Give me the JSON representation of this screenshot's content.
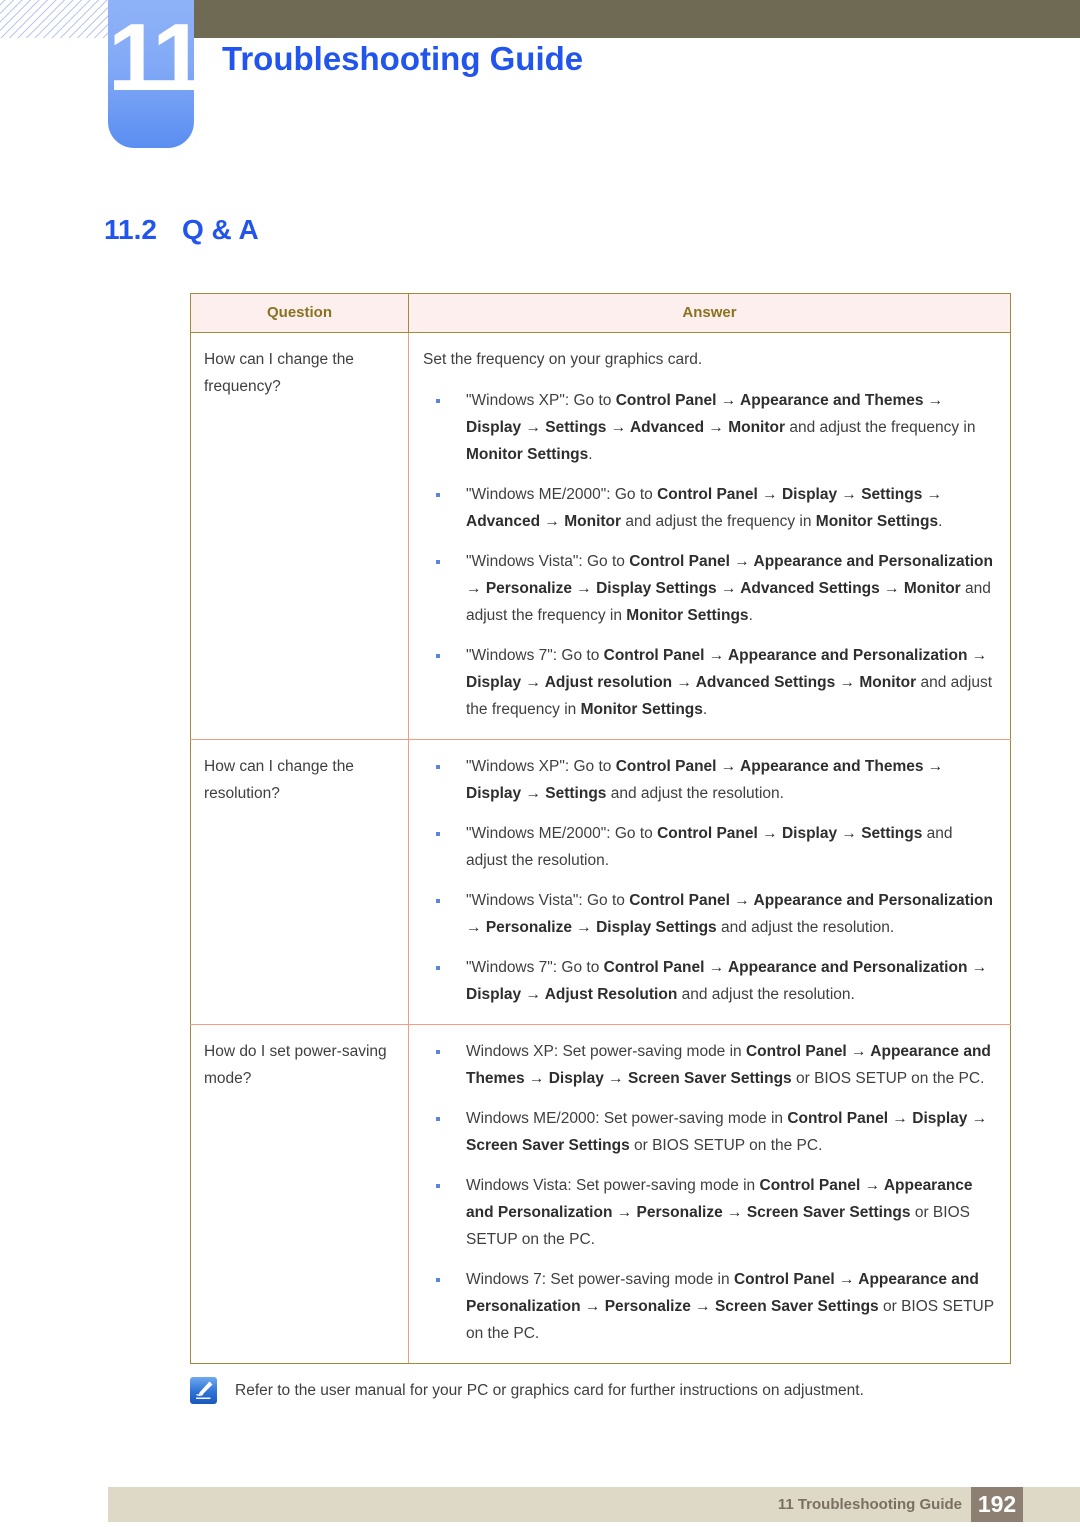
{
  "header": {
    "chapter_number": "11",
    "chapter_title": "Troubleshooting Guide",
    "accent_blue": "#2255ee",
    "khaki_bar_color": "#6e6a54",
    "number_block_color": "#82a9f6"
  },
  "section": {
    "number": "11.2",
    "title": "Q & A"
  },
  "table": {
    "columns": [
      "Question",
      "Answer"
    ],
    "header_text_color": "#8a7320",
    "header_bg_color": "#fcefee",
    "border_color": "#a38a38",
    "row_divider_color": "#ef9e83",
    "rows": [
      {
        "question": "How can I change the frequency?",
        "intro": "Set the frequency on your graphics card.",
        "bullets": [
          {
            "segments": [
              {
                "text": "\"Windows XP\": Go to ",
                "bold": false
              },
              {
                "text": "Control Panel",
                "bold": true
              },
              {
                "text": " → ",
                "bold": true
              },
              {
                "text": "Appearance and Themes",
                "bold": true
              },
              {
                "text": " → ",
                "bold": true
              },
              {
                "text": "Display",
                "bold": true
              },
              {
                "text": " → ",
                "bold": true
              },
              {
                "text": "Settings",
                "bold": true
              },
              {
                "text": " → ",
                "bold": true
              },
              {
                "text": "Advanced",
                "bold": true
              },
              {
                "text": " → ",
                "bold": true
              },
              {
                "text": "Monitor",
                "bold": true
              },
              {
                "text": " and adjust the frequency in ",
                "bold": false
              },
              {
                "text": "Monitor Settings",
                "bold": true
              },
              {
                "text": ".",
                "bold": false
              }
            ]
          },
          {
            "segments": [
              {
                "text": "\"Windows ME/2000\": Go to ",
                "bold": false
              },
              {
                "text": "Control Panel",
                "bold": true
              },
              {
                "text": " → ",
                "bold": true
              },
              {
                "text": "Display",
                "bold": true
              },
              {
                "text": " → ",
                "bold": true
              },
              {
                "text": "Settings",
                "bold": true
              },
              {
                "text": " → ",
                "bold": true
              },
              {
                "text": "Advanced",
                "bold": true
              },
              {
                "text": " → ",
                "bold": true
              },
              {
                "text": "Monitor",
                "bold": true
              },
              {
                "text": " and adjust the frequency in ",
                "bold": false
              },
              {
                "text": "Monitor Settings",
                "bold": true
              },
              {
                "text": ".",
                "bold": false
              }
            ]
          },
          {
            "segments": [
              {
                "text": "\"Windows Vista\": Go to ",
                "bold": false
              },
              {
                "text": "Control Panel",
                "bold": true
              },
              {
                "text": " → ",
                "bold": true
              },
              {
                "text": "Appearance and Personalization",
                "bold": true
              },
              {
                "text": " → ",
                "bold": true
              },
              {
                "text": "Personalize",
                "bold": true
              },
              {
                "text": " → ",
                "bold": true
              },
              {
                "text": "Display Settings",
                "bold": true
              },
              {
                "text": " → ",
                "bold": true
              },
              {
                "text": "Advanced Settings",
                "bold": true
              },
              {
                "text": " → ",
                "bold": true
              },
              {
                "text": "Monitor",
                "bold": true
              },
              {
                "text": " and adjust the frequency in ",
                "bold": false
              },
              {
                "text": "Monitor Settings",
                "bold": true
              },
              {
                "text": ".",
                "bold": false
              }
            ]
          },
          {
            "segments": [
              {
                "text": "\"Windows 7\": Go to ",
                "bold": false
              },
              {
                "text": "Control Panel",
                "bold": true
              },
              {
                "text": " → ",
                "bold": true
              },
              {
                "text": "Appearance and Personalization",
                "bold": true
              },
              {
                "text": " → ",
                "bold": true
              },
              {
                "text": "Display",
                "bold": true
              },
              {
                "text": " → ",
                "bold": true
              },
              {
                "text": "Adjust resolution",
                "bold": true
              },
              {
                "text": " → ",
                "bold": true
              },
              {
                "text": "Advanced Settings",
                "bold": true
              },
              {
                "text": " → ",
                "bold": true
              },
              {
                "text": "Monitor",
                "bold": true
              },
              {
                "text": " and adjust the frequency in ",
                "bold": false
              },
              {
                "text": "Monitor Settings",
                "bold": true
              },
              {
                "text": ".",
                "bold": false
              }
            ]
          }
        ]
      },
      {
        "question": "How can I change the resolution?",
        "intro": "",
        "bullets": [
          {
            "segments": [
              {
                "text": "\"Windows XP\": Go to ",
                "bold": false
              },
              {
                "text": "Control Panel",
                "bold": true
              },
              {
                "text": " → ",
                "bold": true
              },
              {
                "text": "Appearance and Themes",
                "bold": true
              },
              {
                "text": " → ",
                "bold": true
              },
              {
                "text": "Display",
                "bold": true
              },
              {
                "text": " → ",
                "bold": true
              },
              {
                "text": "Settings",
                "bold": true
              },
              {
                "text": " and adjust the resolution.",
                "bold": false
              }
            ]
          },
          {
            "segments": [
              {
                "text": "\"Windows ME/2000\": Go to ",
                "bold": false
              },
              {
                "text": "Control Panel",
                "bold": true
              },
              {
                "text": " → ",
                "bold": true
              },
              {
                "text": "Display",
                "bold": true
              },
              {
                "text": " → ",
                "bold": true
              },
              {
                "text": "Settings",
                "bold": true
              },
              {
                "text": " and adjust the resolution.",
                "bold": false
              }
            ]
          },
          {
            "segments": [
              {
                "text": "\"Windows Vista\": Go to ",
                "bold": false
              },
              {
                "text": "Control Panel",
                "bold": true
              },
              {
                "text": " → ",
                "bold": true
              },
              {
                "text": "Appearance and Personalization",
                "bold": true
              },
              {
                "text": " → ",
                "bold": true
              },
              {
                "text": "Personalize",
                "bold": true
              },
              {
                "text": " → ",
                "bold": true
              },
              {
                "text": "Display Settings",
                "bold": true
              },
              {
                "text": " and adjust the resolution.",
                "bold": false
              }
            ]
          },
          {
            "segments": [
              {
                "text": "\"Windows 7\": Go to ",
                "bold": false
              },
              {
                "text": "Control Panel",
                "bold": true
              },
              {
                "text": " → ",
                "bold": true
              },
              {
                "text": "Appearance and Personalization",
                "bold": true
              },
              {
                "text": " → ",
                "bold": true
              },
              {
                "text": "Display",
                "bold": true
              },
              {
                "text": " → ",
                "bold": true
              },
              {
                "text": "Adjust Resolution",
                "bold": true
              },
              {
                "text": " and adjust the resolution.",
                "bold": false
              }
            ]
          }
        ]
      },
      {
        "question": "How do I set power-saving mode?",
        "intro": "",
        "bullets": [
          {
            "segments": [
              {
                "text": "Windows XP: Set power-saving mode in ",
                "bold": false
              },
              {
                "text": "Control Panel",
                "bold": true
              },
              {
                "text": " → ",
                "bold": true
              },
              {
                "text": "Appearance and Themes",
                "bold": true
              },
              {
                "text": " → ",
                "bold": true
              },
              {
                "text": "Display",
                "bold": true
              },
              {
                "text": " → ",
                "bold": true
              },
              {
                "text": "Screen Saver Settings",
                "bold": true
              },
              {
                "text": " or BIOS SETUP on the PC.",
                "bold": false
              }
            ]
          },
          {
            "segments": [
              {
                "text": "Windows ME/2000: Set power-saving mode in ",
                "bold": false
              },
              {
                "text": "Control Panel",
                "bold": true
              },
              {
                "text": " → ",
                "bold": true
              },
              {
                "text": "Display",
                "bold": true
              },
              {
                "text": " → ",
                "bold": true
              },
              {
                "text": "Screen Saver Settings",
                "bold": true
              },
              {
                "text": " or BIOS SETUP on the PC.",
                "bold": false
              }
            ]
          },
          {
            "segments": [
              {
                "text": "Windows Vista: Set power-saving mode in ",
                "bold": false
              },
              {
                "text": "Control Panel",
                "bold": true
              },
              {
                "text": " → ",
                "bold": true
              },
              {
                "text": "Appearance and Personalization",
                "bold": true
              },
              {
                "text": " → ",
                "bold": true
              },
              {
                "text": "Personalize",
                "bold": true
              },
              {
                "text": " → ",
                "bold": true
              },
              {
                "text": "Screen Saver Settings",
                "bold": true
              },
              {
                "text": " or BIOS SETUP on the PC.",
                "bold": false
              }
            ]
          },
          {
            "segments": [
              {
                "text": "Windows 7: Set power-saving mode in ",
                "bold": false
              },
              {
                "text": "Control Panel",
                "bold": true
              },
              {
                "text": " → ",
                "bold": true
              },
              {
                "text": "Appearance and Personalization",
                "bold": true
              },
              {
                "text": " → ",
                "bold": true
              },
              {
                "text": "Personalize",
                "bold": true
              },
              {
                "text": " → ",
                "bold": true
              },
              {
                "text": "Screen Saver Settings",
                "bold": true
              },
              {
                "text": " or BIOS SETUP on the PC.",
                "bold": false
              }
            ]
          }
        ]
      }
    ]
  },
  "note": {
    "icon": "note-pencil-icon",
    "text": "Refer to the user manual for your PC or graphics card for further instructions on adjustment."
  },
  "footer": {
    "label": "11 Troubleshooting Guide",
    "page_number": "192",
    "bar_color": "#ded9c6",
    "page_box_color": "#8d7f72"
  }
}
